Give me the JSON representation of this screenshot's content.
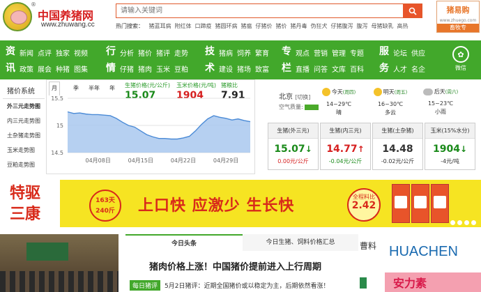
{
  "header": {
    "logo_title": "中国养猪网",
    "logo_url": "www.zhuwang.cc",
    "logo_reg": "®",
    "search_placeholder": "请输入关键词",
    "hot_label": "热门搜索：",
    "hot_words": [
      "猪蓝耳病",
      "附红体",
      "口蹄疫",
      "猪圆环病",
      "猪瘟",
      "仔猪价",
      "猪价",
      "猪丹毒",
      "伪狂犬",
      "仔猪腹泻",
      "腹泻",
      "母猪缺乳",
      "高热"
    ],
    "ad_brand": "猪易购",
    "ad_url": "www.zhuego.com",
    "ad_btn": "畜牧专"
  },
  "nav": {
    "groups": [
      {
        "cat": [
          "资",
          "讯"
        ],
        "row1": [
          "新闻",
          "点评",
          "独家",
          "视频"
        ],
        "row2": [
          "政策",
          "展会",
          "种猪",
          "图集"
        ]
      },
      {
        "cat": [
          "行",
          "情"
        ],
        "row1": [
          "分析",
          "猪价",
          "猪评",
          "走势"
        ],
        "row2": [
          "仔猪",
          "猪肉",
          "玉米",
          "豆粕"
        ]
      },
      {
        "cat": [
          "技",
          "术"
        ],
        "row1": [
          "猪病",
          "饲养",
          "繁育"
        ],
        "row2": [
          "建设",
          "猪场",
          "致富"
        ]
      },
      {
        "cat": [
          "专",
          "栏"
        ],
        "row1": [
          "观点",
          "营销",
          "管理",
          "专题"
        ],
        "row2": [
          "直播",
          "问答",
          "文库",
          "百科"
        ]
      },
      {
        "cat": [
          "服",
          "务"
        ],
        "row1": [
          "论坛",
          "供应"
        ],
        "row2": [
          "人才",
          "名企"
        ]
      }
    ],
    "weixin": "微信"
  },
  "price_side": {
    "title": "猪价系统",
    "items": [
      "外三元走势图",
      "内三元走势图",
      "土杂猪走势图",
      "玉米走势图",
      "豆粕走势图"
    ]
  },
  "chart_tabs": [
    "月",
    "季",
    "半年",
    "年"
  ],
  "price_summary": [
    {
      "label": "生猪价格(元/公斤)",
      "value": "15.07",
      "color": "#1a8a1a"
    },
    {
      "label": "玉米价格(元/吨)",
      "value": "1904",
      "color": "#d62020"
    },
    {
      "label": "猪粮比",
      "value": "7.91",
      "color": "#222222"
    }
  ],
  "chart_data": {
    "type": "area",
    "y_ticks": [
      "15.5",
      "15",
      "14.5"
    ],
    "x_ticks": [
      "04月08日",
      "04月15日",
      "04月22日",
      "04月29日"
    ],
    "ylim": [
      14.5,
      15.5
    ],
    "values": [
      15.25,
      15.22,
      15.23,
      15.21,
      15.2,
      15.2,
      15.19,
      15.18,
      15.13,
      15.06,
      15.0,
      14.97,
      14.9,
      14.83,
      14.79,
      14.76,
      14.76,
      14.75,
      14.75,
      14.77,
      14.8,
      14.9,
      15.02,
      15.12,
      15.18,
      15.15,
      15.13,
      15.1,
      15.12,
      15.09,
      15.07
    ],
    "color": "#4a8ad6"
  },
  "weather": {
    "city": "北京",
    "switch": "[切换]",
    "aqi_label": "空气质量:",
    "days": [
      {
        "name": "今天",
        "weekday": "(周四)",
        "temp": "14~29℃",
        "desc": "晴",
        "icon": "sun-icon"
      },
      {
        "name": "明天",
        "weekday": "(周五)",
        "temp": "16~30℃",
        "desc": "多云",
        "icon": "cloud-sun-icon"
      },
      {
        "name": "后天",
        "weekday": "(周六)",
        "temp": "15~23℃",
        "desc": "小雨",
        "icon": "rain-icon"
      }
    ]
  },
  "price_cards": [
    {
      "title": "生猪(外三元)",
      "value": "15.07",
      "arrow": "↓",
      "change": "0.00元/公斤",
      "color": "#1a8a1a",
      "change_color": "#d62020"
    },
    {
      "title": "生猪(内三元)",
      "value": "14.77",
      "arrow": "↑",
      "change": "-0.04元/公斤",
      "color": "#d62020",
      "change_color": "#1a8a1a"
    },
    {
      "title": "生猪(土杂猪)",
      "value": "14.48",
      "arrow": "",
      "change": "-0.02元/公斤",
      "color": "#333333",
      "change_color": "#333333"
    },
    {
      "title": "玉米(15%水分)",
      "value": "1904",
      "arrow": "↓",
      "change": "-4元/吨",
      "color": "#1a8a1a",
      "change_color": "#333333"
    }
  ],
  "banner": {
    "left_lines": [
      "特驱",
      "三康"
    ],
    "circle_lines": [
      "163天",
      "240斤"
    ],
    "main": "上口快 应激少 生长快",
    "badge_top": "全程料比",
    "badge_value": "2.42"
  },
  "news": {
    "tabs": [
      "今日头条",
      "今日生猪、饲料价格汇总"
    ],
    "headline": "猪肉价格上涨！中国猪价提前进入上行周期",
    "item_tag": "每日猪评",
    "item_text": "5月2日猪评：近期全国猪价或以稳定为主，后期依然看涨！"
  },
  "side_feed": "曹料",
  "ad_huacher": {
    "logo": "HUACHEN",
    "text": "安力素"
  }
}
